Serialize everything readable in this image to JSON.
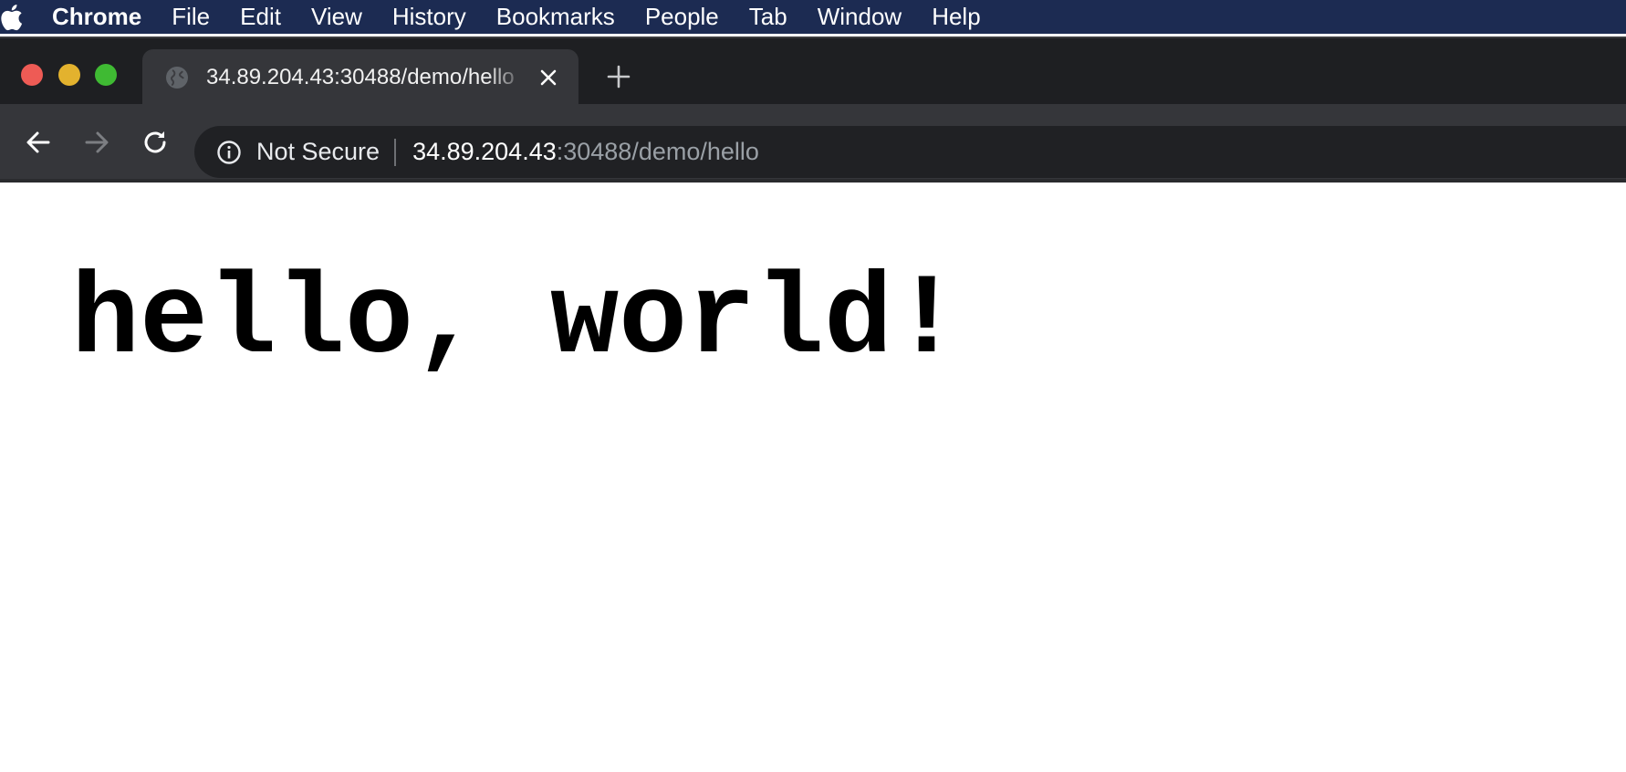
{
  "menubar": {
    "apple_icon": "apple-logo-icon",
    "app_name": "Chrome",
    "items": [
      "File",
      "Edit",
      "View",
      "History",
      "Bookmarks",
      "People",
      "Tab",
      "Window",
      "Help"
    ]
  },
  "window": {
    "traffic_lights": {
      "close": "#ee5b55",
      "minimize": "#e3b22e",
      "zoom": "#3fba33"
    }
  },
  "tab": {
    "favicon": "globe-icon",
    "title": "34.89.204.43:30488/demo/hello",
    "close_icon": "close-icon",
    "new_tab_icon": "plus-icon"
  },
  "toolbar": {
    "back_icon": "arrow-left-icon",
    "forward_icon": "arrow-right-icon",
    "reload_icon": "reload-icon",
    "security_icon": "info-icon",
    "security_text": "Not Secure",
    "url_host": "34.89.204.43",
    "url_rest": ":30488/demo/hello"
  },
  "page": {
    "text": "hello, world!"
  },
  "colors": {
    "menubar_bg": "#1c2b52",
    "tabstrip_bg": "#1e1f22",
    "active_tab_bg": "#35363a",
    "omnibox_bg": "#202124",
    "page_bg": "#ffffff"
  }
}
